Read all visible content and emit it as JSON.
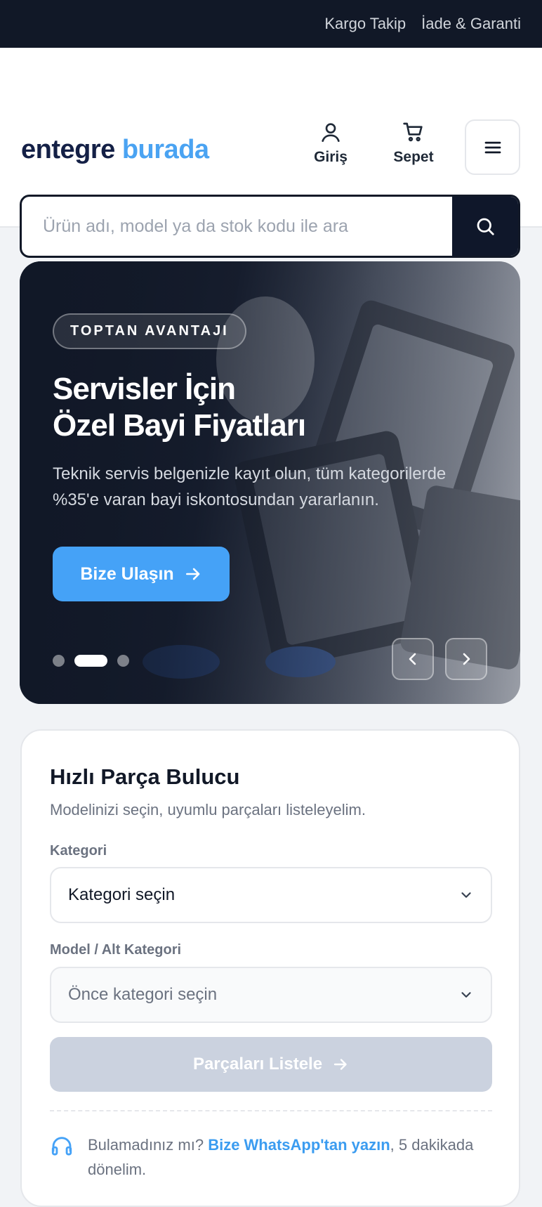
{
  "topbar": {
    "links": [
      "Kargo Takip",
      "İade & Garanti"
    ]
  },
  "header": {
    "logo": {
      "part1": "entegre",
      "part2": "burada"
    },
    "login_label": "Giriş",
    "cart_label": "Sepet"
  },
  "search": {
    "placeholder": "Ürün adı, model ya da stok kodu ile ara"
  },
  "hero": {
    "badge": "TOPTAN AVANTAJI",
    "title_line1": "Servisler İçin",
    "title_line2": "Özel Bayi Fiyatları",
    "description": "Teknik servis belgenizle kayıt olun, tüm kategorilerde %35'e varan bayi iskontosundan yararlanın.",
    "cta_label": "Bize Ulaşın",
    "slide_count": 3,
    "active_slide": 2
  },
  "finder": {
    "title": "Hızlı Parça Bulucu",
    "subtitle": "Modelinizi seçin, uyumlu parçaları listeleyelim.",
    "category_label": "Kategori",
    "category_value": "Kategori seçin",
    "model_label": "Model / Alt Kategori",
    "model_value": "Önce kategori seçin",
    "submit_label": "Parçaları Listele",
    "help_prefix": "Bulamadınız mı? ",
    "help_link": "Bize WhatsApp'tan yazın",
    "help_suffix": ", 5 dakikada dönelim."
  },
  "colors": {
    "dark": "#111827",
    "accent": "#45a2f7",
    "logo_dark": "#142046",
    "logo_light": "#4aa3f2",
    "disabled_button": "#cbd2df"
  },
  "icons": [
    "user-icon",
    "cart-icon",
    "hamburger-menu-icon",
    "search-icon",
    "arrow-right-icon",
    "chevron-left-icon",
    "chevron-right-icon",
    "chevron-down-icon",
    "headphones-icon"
  ]
}
